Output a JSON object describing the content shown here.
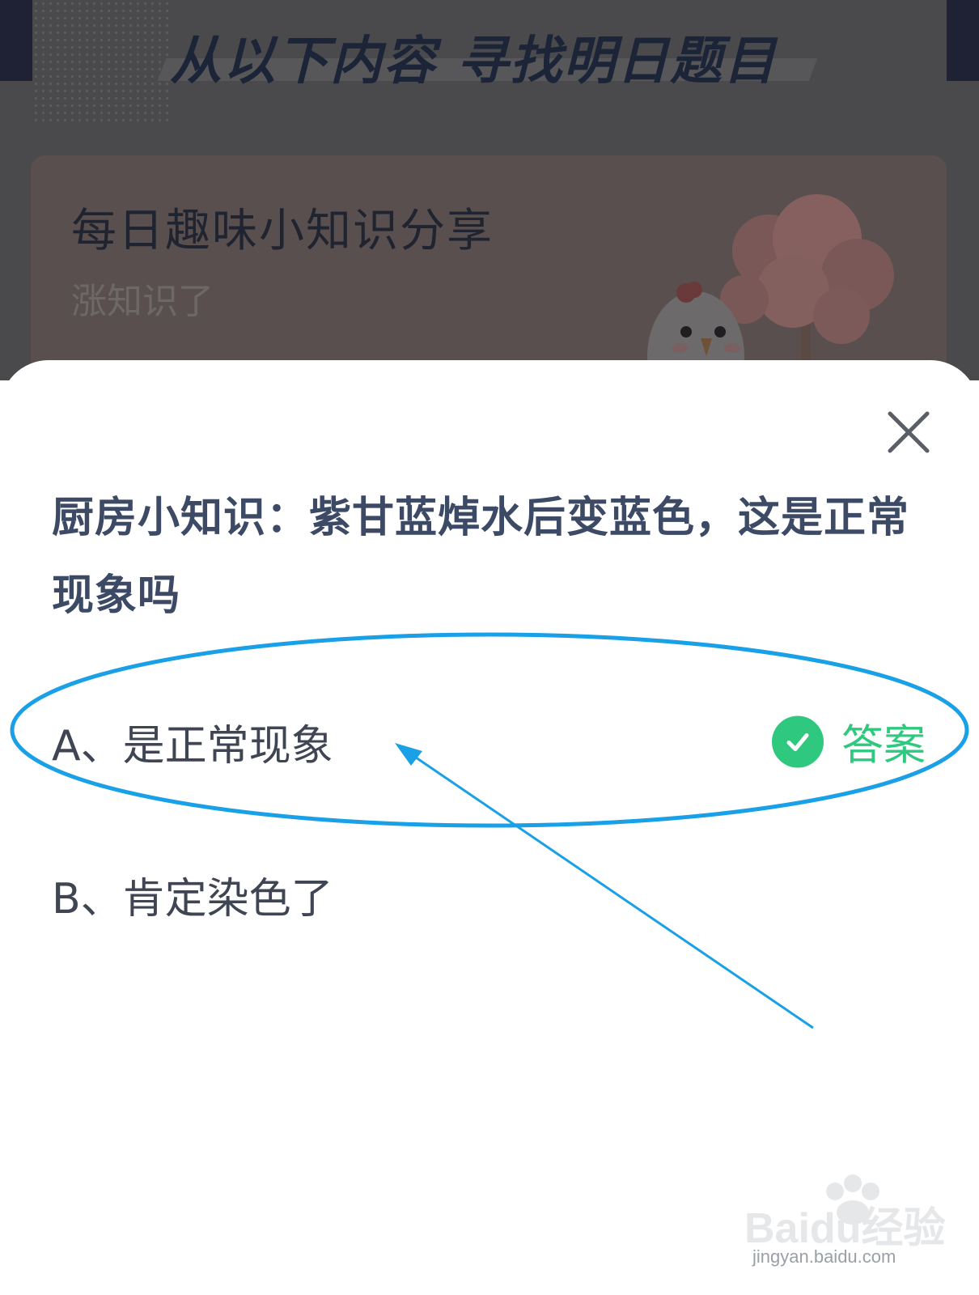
{
  "background": {
    "banner_title": "从以下内容  寻找明日题目",
    "card": {
      "title": "每日趣味小知识分享",
      "subtitle": "涨知识了"
    }
  },
  "modal": {
    "question": "厨房小知识：紫甘蓝焯水后变蓝色，这是正常现象吗",
    "options": [
      {
        "label": "A、是正常现象",
        "is_answer": true
      },
      {
        "label": "B、肯定染色了",
        "is_answer": false
      }
    ],
    "answer_label": "答案",
    "close_icon": "close-icon"
  },
  "colors": {
    "accent_green": "#2fc87f",
    "question_text": "#3d4a66",
    "annotation_blue": "#1aa0e6"
  },
  "watermark": {
    "brand": "Baidu经验",
    "url": "jingyan.baidu.com"
  }
}
